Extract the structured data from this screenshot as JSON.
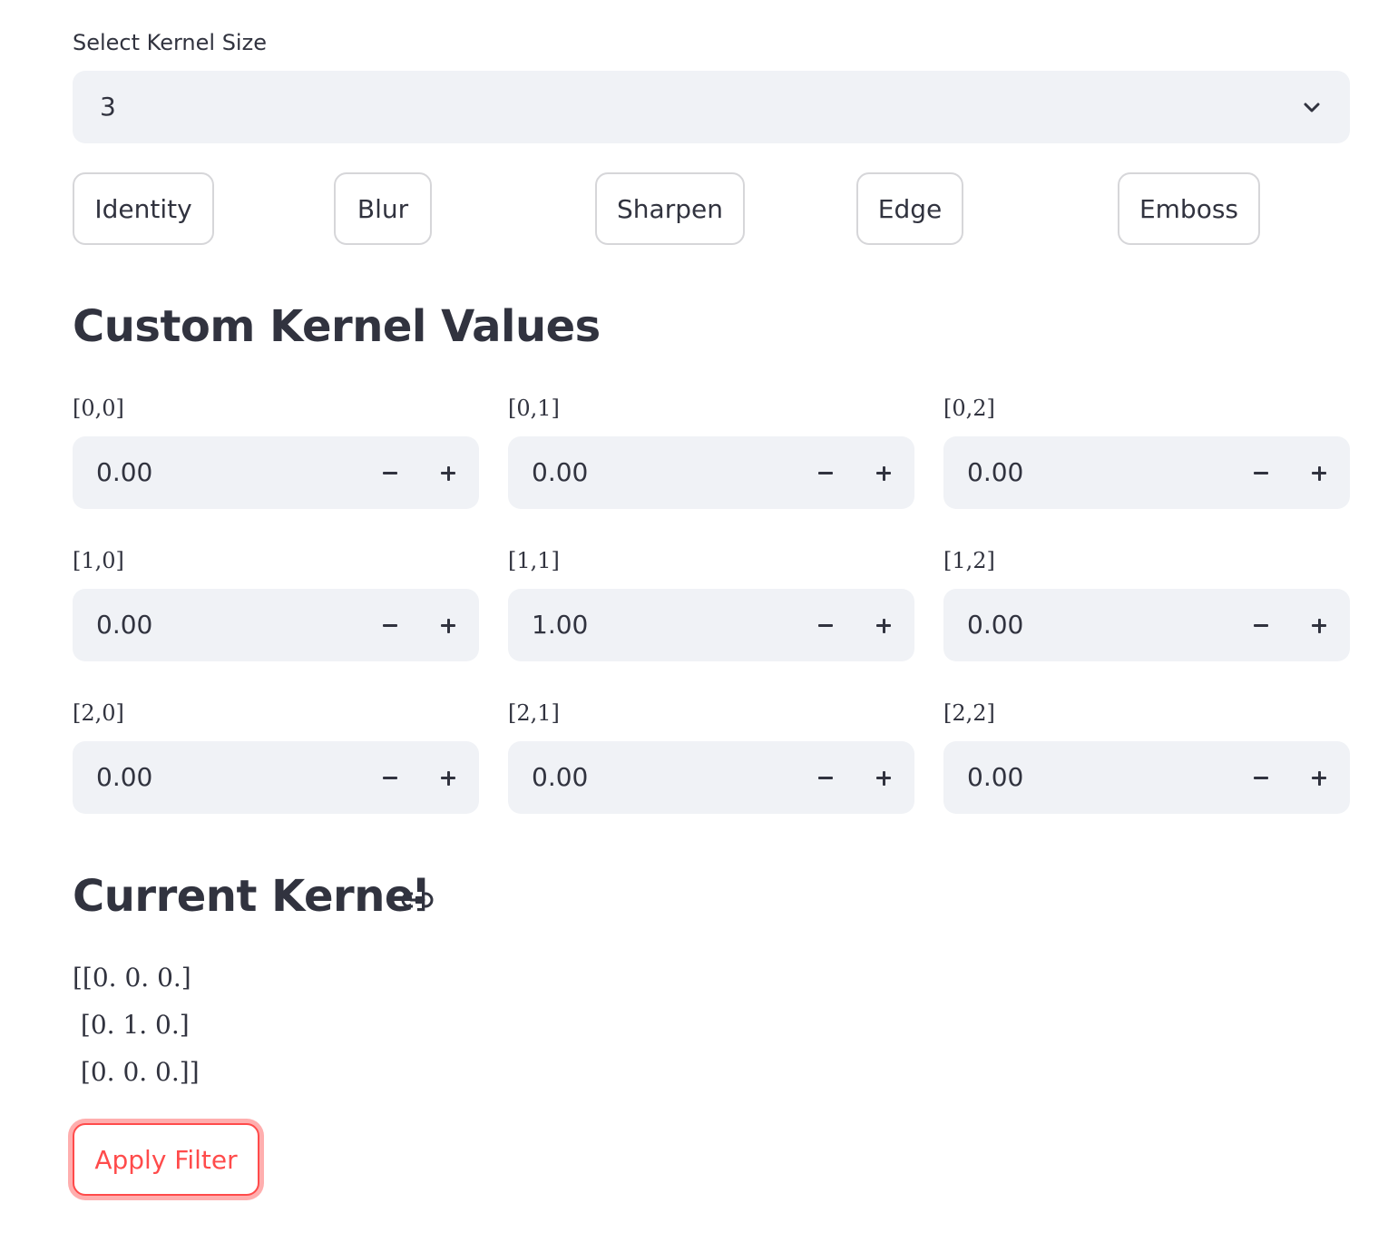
{
  "kernel_size": {
    "label": "Select Kernel Size",
    "selected": "3"
  },
  "presets": [
    "Identity",
    "Blur",
    "Sharpen",
    "Edge",
    "Emboss"
  ],
  "custom_section": {
    "heading": "Custom Kernel Values"
  },
  "cells": [
    {
      "label": "[0,0]",
      "value": "0.00"
    },
    {
      "label": "[0,1]",
      "value": "0.00"
    },
    {
      "label": "[0,2]",
      "value": "0.00"
    },
    {
      "label": "[1,0]",
      "value": "0.00"
    },
    {
      "label": "[1,1]",
      "value": "1.00"
    },
    {
      "label": "[1,2]",
      "value": "0.00"
    },
    {
      "label": "[2,0]",
      "value": "0.00"
    },
    {
      "label": "[2,1]",
      "value": "0.00"
    },
    {
      "label": "[2,2]",
      "value": "0.00"
    }
  ],
  "current_kernel": {
    "heading": "Current Kernel",
    "lines": [
      "[[0. 0. 0.]",
      " [0. 1. 0.]",
      " [0. 0. 0.]]"
    ]
  },
  "apply_button": {
    "label": "Apply Filter",
    "color": "#ff4b4b"
  },
  "icons": {
    "select": "chevron-down-icon",
    "heading_anchor": "link-icon"
  }
}
